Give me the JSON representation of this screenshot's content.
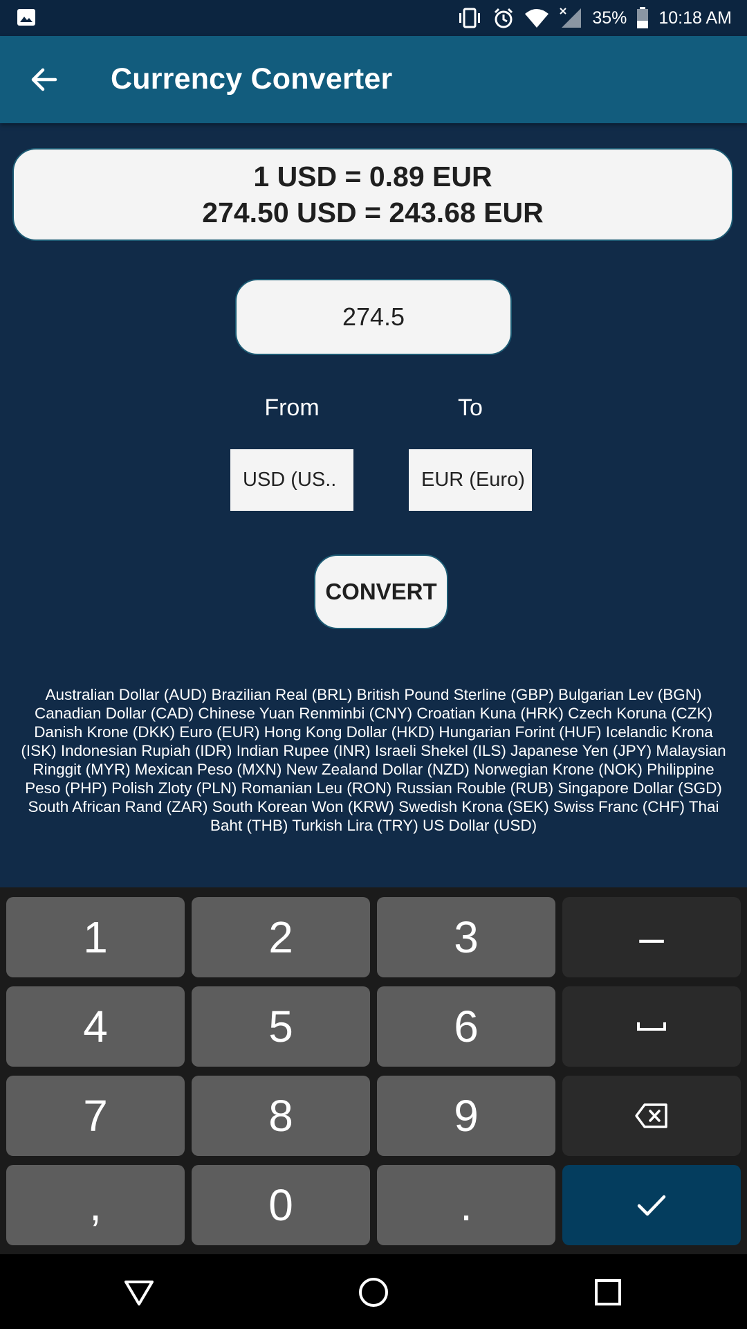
{
  "status_bar": {
    "battery": "35%",
    "time": "10:18 AM",
    "icons": [
      "image-icon",
      "vibrate-icon",
      "alarm-icon",
      "wifi-icon",
      "signal-icon",
      "battery-icon"
    ]
  },
  "app_bar": {
    "title": "Currency Converter",
    "back_icon": "arrow-left-icon"
  },
  "result": {
    "line1": "1 USD = 0.89 EUR",
    "line2": "274.50 USD = 243.68 EUR"
  },
  "amount_input": {
    "value": "274.5"
  },
  "from_label": "From",
  "to_label": "To",
  "from_select": "USD (US..",
  "to_select": "EUR (Euro)",
  "convert_button": "CONVERT",
  "currency_list": "Australian Dollar (AUD) Brazilian Real (BRL) British Pound Sterline (GBP) Bulgarian Lev (BGN) Canadian Dollar (CAD) Chinese Yuan Renminbi (CNY) Croatian Kuna (HRK) Czech Koruna (CZK) Danish Krone (DKK) Euro (EUR) Hong Kong Dollar (HKD) Hungarian Forint (HUF) Icelandic Krona (ISK) Indonesian Rupiah (IDR) Indian Rupee (INR) Israeli Shekel (ILS) Japanese Yen (JPY) Malaysian Ringgit (MYR) Mexican Peso (MXN) New Zealand Dollar (NZD) Norwegian Krone (NOK) Philippine Peso (PHP) Polish Zloty (PLN) Romanian Leu (RON) Russian Rouble (RUB) Singapore Dollar (SGD) South African Rand (ZAR) South Korean Won (KRW) Swedish Krona (SEK) Swiss Franc (CHF) Thai Baht (THB) Turkish Lira (TRY) US Dollar (USD)",
  "keyboard": {
    "keys": [
      "1",
      "2",
      "3",
      "–",
      "4",
      "5",
      "6",
      "␣",
      "7",
      "8",
      "9",
      "⌫",
      ",",
      "0",
      ".",
      "✓"
    ]
  },
  "navbar": {
    "icons": [
      "back-triangle-icon",
      "home-circle-icon",
      "recents-square-icon"
    ]
  },
  "colors": {
    "background": "#112b48",
    "app_bar": "#125c7d",
    "enter_key": "#043d5e"
  }
}
